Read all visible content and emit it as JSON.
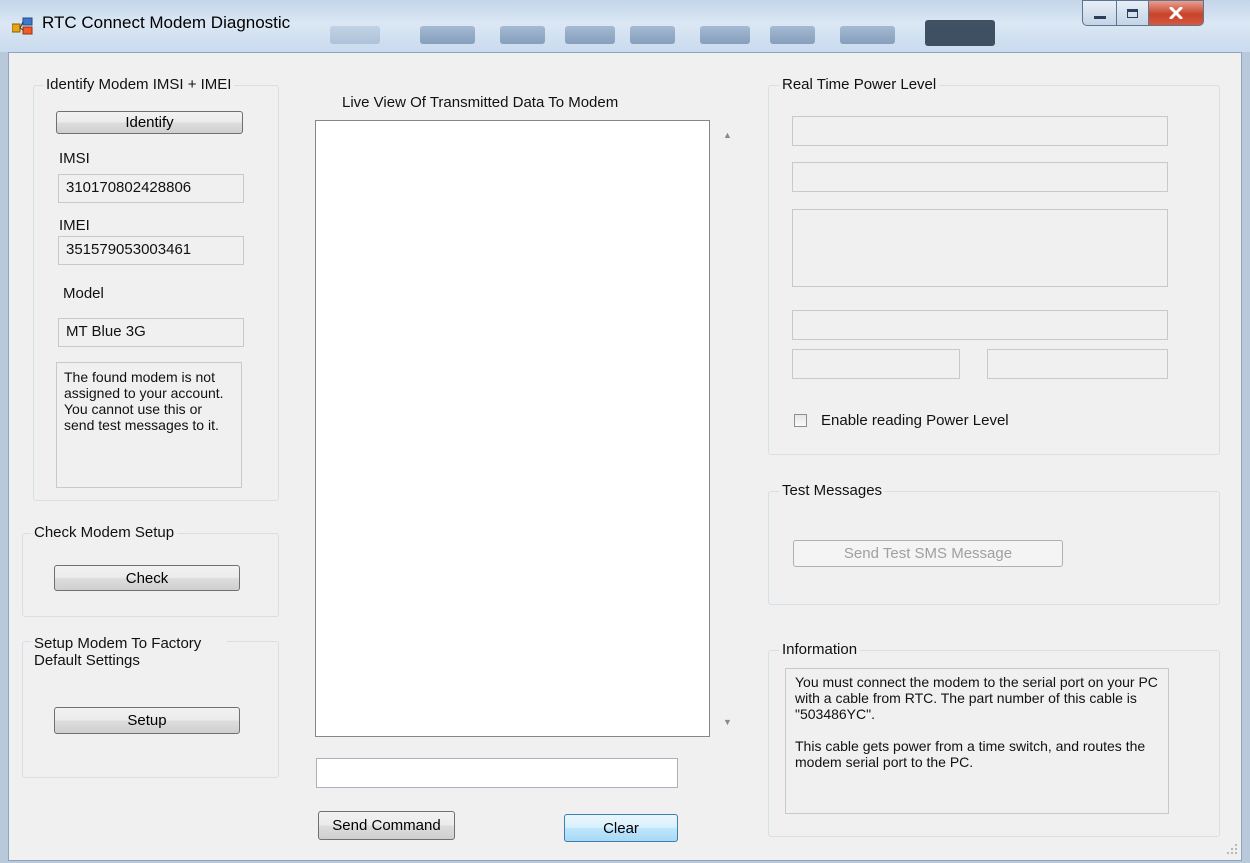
{
  "window": {
    "title": "RTC Connect Modem Diagnostic",
    "buttons": {
      "minimize_icon": "minimize-icon",
      "maximize_icon": "maximize-icon",
      "close_icon": "close-icon"
    }
  },
  "identify_group": {
    "legend": "Identify Modem IMSI + IMEI",
    "button_label": "Identify",
    "imsi_label": "IMSI",
    "imsi_value": "310170802428806",
    "imei_label": "IMEI",
    "imei_value": "351579053003461",
    "model_label": "Model",
    "model_value": "MT Blue 3G",
    "status_message": "The found modem is not assigned to your account.  You cannot use this or send test messages to it."
  },
  "check_group": {
    "legend": "Check Modem Setup",
    "button_label": "Check"
  },
  "setup_group": {
    "legend": "Setup Modem To Factory Default Settings",
    "button_label": "Setup"
  },
  "live_view": {
    "label": "Live View Of Transmitted Data To Modem",
    "content": "",
    "command_value": "",
    "send_label": "Send Command",
    "clear_label": "Clear"
  },
  "power_group": {
    "legend": "Real Time Power Level",
    "field1": "",
    "field2": "",
    "field3": "",
    "field4": "",
    "field5": "",
    "field6": "",
    "checkbox_label": "Enable reading Power Level",
    "checkbox_checked": false
  },
  "test_group": {
    "legend": "Test Messages",
    "button_label": "Send Test SMS Message"
  },
  "info_group": {
    "legend": "Information",
    "para1": "You must connect the modem to the serial port on your PC with a cable from RTC.  The part number of this cable is \"503486YC\".",
    "para2": "This cable gets power from a time switch, and routes the modem serial port to the PC."
  },
  "colors": {
    "frame": "#c4d6ea",
    "client_bg": "#f0f0f0",
    "close_red": "#c7432a",
    "focus_blue": "#3c7fb1"
  }
}
